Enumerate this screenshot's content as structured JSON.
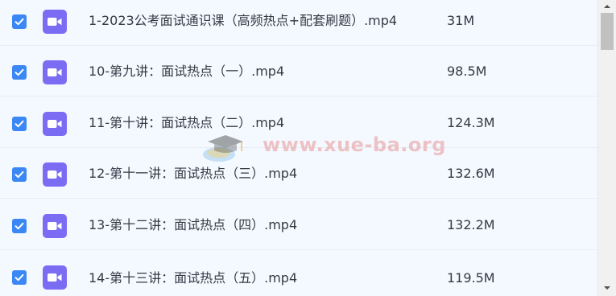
{
  "files": [
    {
      "name": "1-2023公考面试通识课（高频热点+配套刷题）.mp4",
      "size": "31M",
      "checked": true,
      "icon": "video-file-icon"
    },
    {
      "name": "10-第九讲：面试热点（一）.mp4",
      "size": "98.5M",
      "checked": true,
      "icon": "video-file-icon"
    },
    {
      "name": "11-第十讲：面试热点（二）.mp4",
      "size": "124.3M",
      "checked": true,
      "icon": "video-file-icon"
    },
    {
      "name": "12-第十一讲：面试热点（三）.mp4",
      "size": "132.6M",
      "checked": true,
      "icon": "video-file-icon"
    },
    {
      "name": "13-第十二讲：面试热点（四）.mp4",
      "size": "132.2M",
      "checked": true,
      "icon": "video-file-icon"
    },
    {
      "name": "14-第十三讲：面试热点（五）.mp4",
      "size": "119.5M",
      "checked": true,
      "icon": "video-file-icon"
    }
  ],
  "watermark": {
    "text": "www.xue-ba.org"
  },
  "colors": {
    "checkbox": "#3b88f5",
    "file_icon": "#7b6cf4",
    "row_background": "#f4f9ff",
    "text": "#333a45"
  },
  "scrollbar": {
    "up_icon": "scroll-up-arrow-icon",
    "down_icon": "scroll-down-arrow-icon"
  }
}
